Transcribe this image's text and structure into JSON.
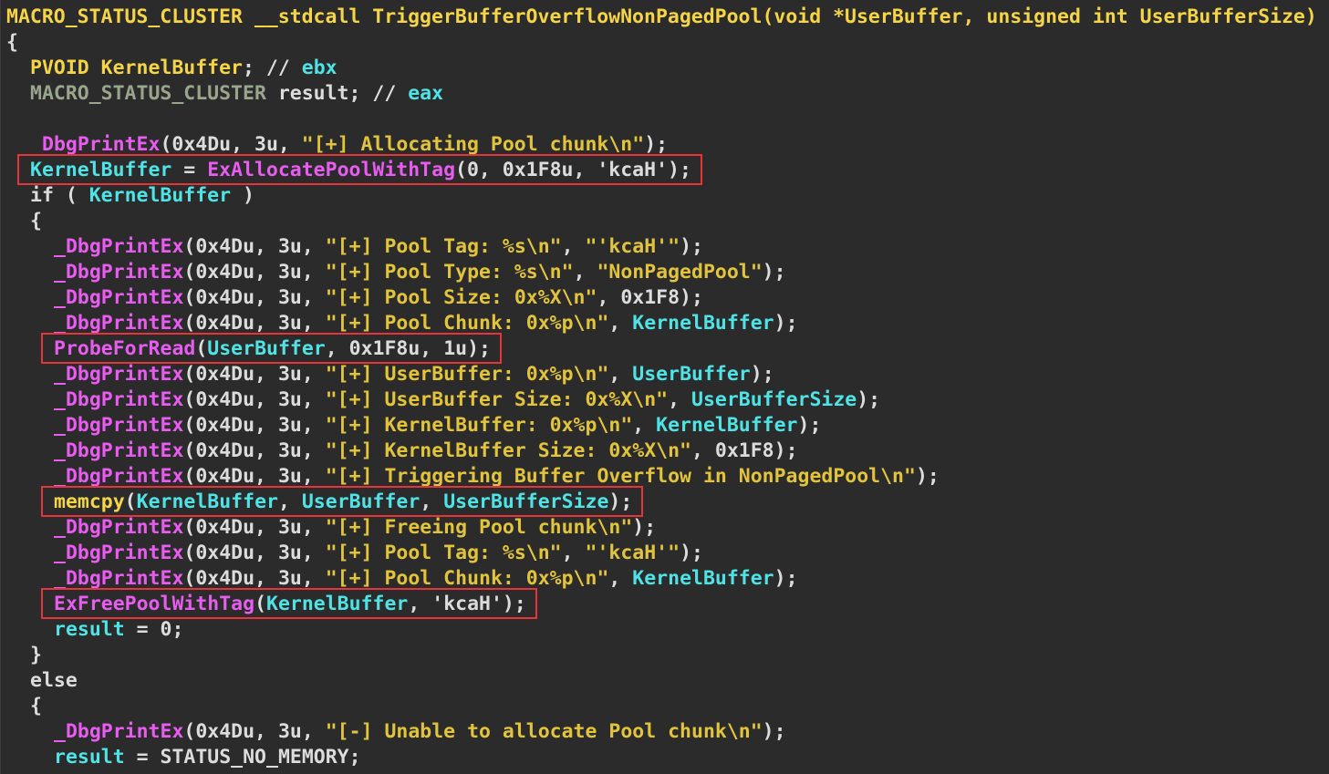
{
  "colors": {
    "background": "#2b2b2b",
    "plain": "#dcdcdc",
    "type": "#f5d547",
    "type_dim": "#9aa58e",
    "func": "#f5d547",
    "ident": "#4fe3e6",
    "import": "#e85cf0",
    "string": "#e2c43c",
    "number": "#d8d8d8",
    "keyword": "#dcdcdc",
    "comment": "#dcdcdc",
    "highlight_box": "#e5353b"
  },
  "code_lines": [
    {
      "indent": 0,
      "tokens": [
        {
          "t": "MACRO_STATUS_CLUSTER",
          "c": "type"
        },
        {
          "t": " __stdcall ",
          "c": "type"
        },
        {
          "t": "TriggerBufferOverflowNonPagedPool",
          "c": "func"
        },
        {
          "t": "(void *UserBuffer, unsigned int UserBufferSize)",
          "c": "type"
        }
      ]
    },
    {
      "indent": 0,
      "tokens": [
        {
          "t": "{",
          "c": "plain"
        }
      ]
    },
    {
      "indent": 2,
      "tokens": [
        {
          "t": "PVOID ",
          "c": "type"
        },
        {
          "t": "KernelBuffer",
          "c": "type"
        },
        {
          "t": "; // ",
          "c": "plain"
        },
        {
          "t": "ebx",
          "c": "ident"
        }
      ]
    },
    {
      "indent": 2,
      "tokens": [
        {
          "t": "MACRO_STATUS_CLUSTER ",
          "c": "type_dim"
        },
        {
          "t": "result",
          "c": "plain"
        },
        {
          "t": "; // ",
          "c": "plain"
        },
        {
          "t": "eax",
          "c": "ident"
        }
      ]
    },
    {
      "indent": 0,
      "tokens": []
    },
    {
      "indent": 3,
      "tokens": [
        {
          "t": "DbgPrintEx",
          "c": "import"
        },
        {
          "t": "(0x4Du, 3u, ",
          "c": "plain"
        },
        {
          "t": "\"[+] Allocating Pool chunk\\n\"",
          "c": "string"
        },
        {
          "t": ");",
          "c": "plain"
        }
      ]
    },
    {
      "indent": 2,
      "tokens": [
        {
          "t": "KernelBuffer",
          "c": "ident"
        },
        {
          "t": " = ",
          "c": "plain"
        },
        {
          "t": "ExAllocatePoolWithTag",
          "c": "import"
        },
        {
          "t": "(0, 0x1F8u, 'kcaH');",
          "c": "plain"
        }
      ]
    },
    {
      "indent": 2,
      "tokens": [
        {
          "t": "if ( ",
          "c": "plain"
        },
        {
          "t": "KernelBuffer",
          "c": "ident"
        },
        {
          "t": " )",
          "c": "plain"
        }
      ]
    },
    {
      "indent": 2,
      "tokens": [
        {
          "t": "{",
          "c": "plain"
        }
      ]
    },
    {
      "indent": 4,
      "tokens": [
        {
          "t": "_DbgPrintEx",
          "c": "import"
        },
        {
          "t": "(0x4Du, 3u, ",
          "c": "plain"
        },
        {
          "t": "\"[+] Pool Tag: %s\\n\"",
          "c": "string"
        },
        {
          "t": ", ",
          "c": "plain"
        },
        {
          "t": "\"'kcaH'\"",
          "c": "string"
        },
        {
          "t": ");",
          "c": "plain"
        }
      ]
    },
    {
      "indent": 4,
      "tokens": [
        {
          "t": "_DbgPrintEx",
          "c": "import"
        },
        {
          "t": "(0x4Du, 3u, ",
          "c": "plain"
        },
        {
          "t": "\"[+] Pool Type: %s\\n\"",
          "c": "string"
        },
        {
          "t": ", ",
          "c": "plain"
        },
        {
          "t": "\"NonPagedPool\"",
          "c": "string"
        },
        {
          "t": ");",
          "c": "plain"
        }
      ]
    },
    {
      "indent": 4,
      "tokens": [
        {
          "t": "_DbgPrintEx",
          "c": "import"
        },
        {
          "t": "(0x4Du, 3u, ",
          "c": "plain"
        },
        {
          "t": "\"[+] Pool Size: 0x%X\\n\"",
          "c": "string"
        },
        {
          "t": ", 0x1F8);",
          "c": "plain"
        }
      ]
    },
    {
      "indent": 4,
      "tokens": [
        {
          "t": "_DbgPrintEx",
          "c": "import"
        },
        {
          "t": "(0x4Du, 3u, ",
          "c": "plain"
        },
        {
          "t": "\"[+] Pool Chunk: 0x%p\\n\"",
          "c": "string"
        },
        {
          "t": ", ",
          "c": "plain"
        },
        {
          "t": "KernelBuffer",
          "c": "ident"
        },
        {
          "t": ");",
          "c": "plain"
        }
      ]
    },
    {
      "indent": 4,
      "tokens": [
        {
          "t": "ProbeForRead",
          "c": "import"
        },
        {
          "t": "(",
          "c": "plain"
        },
        {
          "t": "UserBuffer",
          "c": "ident"
        },
        {
          "t": ", 0x1F8u, 1u);",
          "c": "plain"
        }
      ]
    },
    {
      "indent": 4,
      "tokens": [
        {
          "t": "_DbgPrintEx",
          "c": "import"
        },
        {
          "t": "(0x4Du, 3u, ",
          "c": "plain"
        },
        {
          "t": "\"[+] UserBuffer: 0x%p\\n\"",
          "c": "string"
        },
        {
          "t": ", ",
          "c": "plain"
        },
        {
          "t": "UserBuffer",
          "c": "ident"
        },
        {
          "t": ");",
          "c": "plain"
        }
      ]
    },
    {
      "indent": 4,
      "tokens": [
        {
          "t": "_DbgPrintEx",
          "c": "import"
        },
        {
          "t": "(0x4Du, 3u, ",
          "c": "plain"
        },
        {
          "t": "\"[+] UserBuffer Size: 0x%X\\n\"",
          "c": "string"
        },
        {
          "t": ", ",
          "c": "plain"
        },
        {
          "t": "UserBufferSize",
          "c": "ident"
        },
        {
          "t": ");",
          "c": "plain"
        }
      ]
    },
    {
      "indent": 4,
      "tokens": [
        {
          "t": "_DbgPrintEx",
          "c": "import"
        },
        {
          "t": "(0x4Du, 3u, ",
          "c": "plain"
        },
        {
          "t": "\"[+] KernelBuffer: 0x%p\\n\"",
          "c": "string"
        },
        {
          "t": ", ",
          "c": "plain"
        },
        {
          "t": "KernelBuffer",
          "c": "ident"
        },
        {
          "t": ");",
          "c": "plain"
        }
      ]
    },
    {
      "indent": 4,
      "tokens": [
        {
          "t": "_DbgPrintEx",
          "c": "import"
        },
        {
          "t": "(0x4Du, 3u, ",
          "c": "plain"
        },
        {
          "t": "\"[+] KernelBuffer Size: 0x%X\\n\"",
          "c": "string"
        },
        {
          "t": ", 0x1F8);",
          "c": "plain"
        }
      ]
    },
    {
      "indent": 4,
      "tokens": [
        {
          "t": "_DbgPrintEx",
          "c": "import"
        },
        {
          "t": "(0x4Du, 3u, ",
          "c": "plain"
        },
        {
          "t": "\"[+] Triggering Buffer Overflow in NonPagedPool\\n\"",
          "c": "string"
        },
        {
          "t": ");",
          "c": "plain"
        }
      ]
    },
    {
      "indent": 4,
      "tokens": [
        {
          "t": "memcpy",
          "c": "type"
        },
        {
          "t": "(",
          "c": "plain"
        },
        {
          "t": "KernelBuffer",
          "c": "ident"
        },
        {
          "t": ", ",
          "c": "plain"
        },
        {
          "t": "UserBuffer",
          "c": "ident"
        },
        {
          "t": ", ",
          "c": "plain"
        },
        {
          "t": "UserBufferSize",
          "c": "ident"
        },
        {
          "t": ");",
          "c": "plain"
        }
      ]
    },
    {
      "indent": 4,
      "tokens": [
        {
          "t": "_DbgPrintEx",
          "c": "import"
        },
        {
          "t": "(0x4Du, 3u, ",
          "c": "plain"
        },
        {
          "t": "\"[+] Freeing Pool chunk\\n\"",
          "c": "string"
        },
        {
          "t": ");",
          "c": "plain"
        }
      ]
    },
    {
      "indent": 4,
      "tokens": [
        {
          "t": "_DbgPrintEx",
          "c": "import"
        },
        {
          "t": "(0x4Du, 3u, ",
          "c": "plain"
        },
        {
          "t": "\"[+] Pool Tag: %s\\n\"",
          "c": "string"
        },
        {
          "t": ", ",
          "c": "plain"
        },
        {
          "t": "\"'kcaH'\"",
          "c": "string"
        },
        {
          "t": ");",
          "c": "plain"
        }
      ]
    },
    {
      "indent": 4,
      "tokens": [
        {
          "t": "_DbgPrintEx",
          "c": "import"
        },
        {
          "t": "(0x4Du, 3u, ",
          "c": "plain"
        },
        {
          "t": "\"[+] Pool Chunk: 0x%p\\n\"",
          "c": "string"
        },
        {
          "t": ", ",
          "c": "plain"
        },
        {
          "t": "KernelBuffer",
          "c": "ident"
        },
        {
          "t": ");",
          "c": "plain"
        }
      ]
    },
    {
      "indent": 4,
      "tokens": [
        {
          "t": "ExFreePoolWithTag",
          "c": "import"
        },
        {
          "t": "(",
          "c": "plain"
        },
        {
          "t": "KernelBuffer",
          "c": "ident"
        },
        {
          "t": ", 'kcaH');",
          "c": "plain"
        }
      ]
    },
    {
      "indent": 4,
      "tokens": [
        {
          "t": "result",
          "c": "ident"
        },
        {
          "t": " = 0;",
          "c": "plain"
        }
      ]
    },
    {
      "indent": 2,
      "tokens": [
        {
          "t": "}",
          "c": "plain"
        }
      ]
    },
    {
      "indent": 2,
      "tokens": [
        {
          "t": "else",
          "c": "plain"
        }
      ]
    },
    {
      "indent": 2,
      "tokens": [
        {
          "t": "{",
          "c": "plain"
        }
      ]
    },
    {
      "indent": 4,
      "tokens": [
        {
          "t": "_DbgPrintEx",
          "c": "import"
        },
        {
          "t": "(0x4Du, 3u, ",
          "c": "plain"
        },
        {
          "t": "\"[-] Unable to allocate Pool chunk\\n\"",
          "c": "string"
        },
        {
          "t": ");",
          "c": "plain"
        }
      ]
    },
    {
      "indent": 4,
      "tokens": [
        {
          "t": "result",
          "c": "ident"
        },
        {
          "t": " = STATUS_NO_MEMORY;",
          "c": "plain"
        }
      ]
    }
  ],
  "highlighted_lines": [
    6,
    13,
    19,
    23
  ]
}
